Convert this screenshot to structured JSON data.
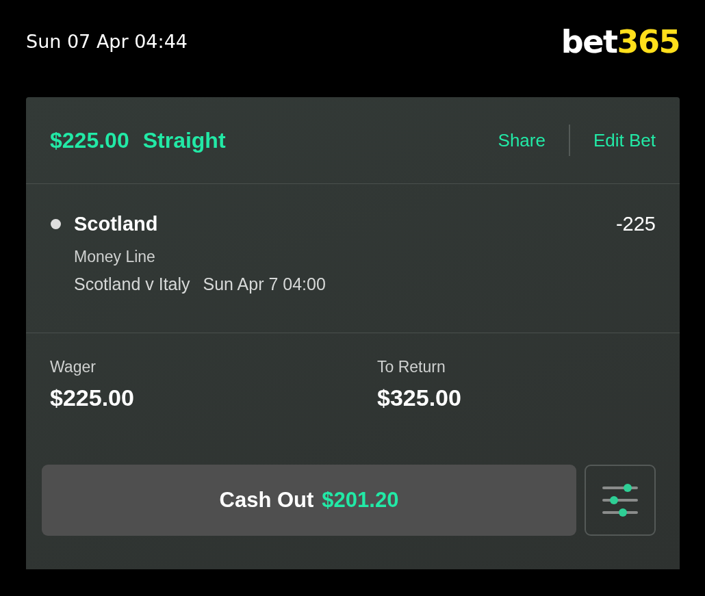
{
  "status_bar": {
    "time": "Sun 07 Apr 04:44"
  },
  "logo": {
    "text": "bet",
    "accent": "365"
  },
  "bet": {
    "stake": "$225.00",
    "type": "Straight",
    "actions": [
      "Share",
      "Edit Bet"
    ],
    "selection": {
      "name": "Scotland",
      "odds": "-225",
      "market": "Money Line",
      "event": "Scotland v Italy",
      "start_time": "Sun Apr 7 04:00"
    },
    "summary": [
      {
        "label": "Wager",
        "value": "$225.00"
      },
      {
        "label": "To Return",
        "value": "$325.00"
      }
    ],
    "cash_out": {
      "label": "Cash Out",
      "amount": "$201.20"
    }
  }
}
